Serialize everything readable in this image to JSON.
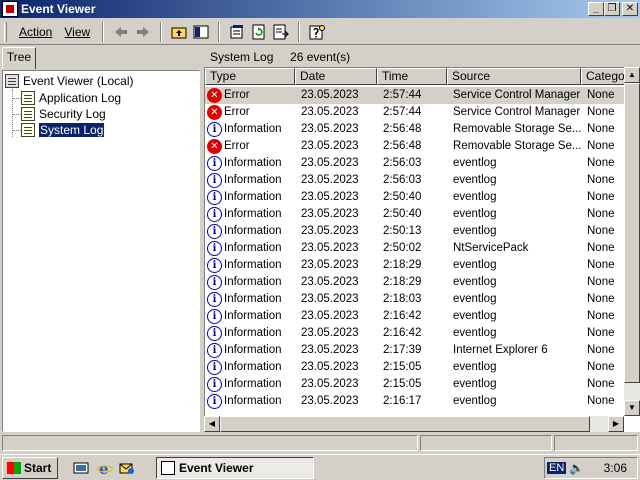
{
  "window": {
    "title": "Event Viewer"
  },
  "menu": {
    "action": "Action",
    "view": "View"
  },
  "tree": {
    "tab_label": "Tree",
    "root": "Event Viewer (Local)",
    "items": [
      "Application Log",
      "Security Log",
      "System Log"
    ],
    "selected": "System Log"
  },
  "header": {
    "log_name": "System Log",
    "event_count": "26 event(s)"
  },
  "columns": [
    "Type",
    "Date",
    "Time",
    "Source",
    "Catego"
  ],
  "rows": [
    {
      "type": "Error",
      "date": "23.05.2023",
      "time": "2:57:44",
      "source": "Service Control Manager",
      "category": "None"
    },
    {
      "type": "Error",
      "date": "23.05.2023",
      "time": "2:57:44",
      "source": "Service Control Manager",
      "category": "None"
    },
    {
      "type": "Information",
      "date": "23.05.2023",
      "time": "2:56:48",
      "source": "Removable Storage Se...",
      "category": "None"
    },
    {
      "type": "Error",
      "date": "23.05.2023",
      "time": "2:56:48",
      "source": "Removable Storage Se...",
      "category": "None"
    },
    {
      "type": "Information",
      "date": "23.05.2023",
      "time": "2:56:03",
      "source": "eventlog",
      "category": "None"
    },
    {
      "type": "Information",
      "date": "23.05.2023",
      "time": "2:56:03",
      "source": "eventlog",
      "category": "None"
    },
    {
      "type": "Information",
      "date": "23.05.2023",
      "time": "2:50:40",
      "source": "eventlog",
      "category": "None"
    },
    {
      "type": "Information",
      "date": "23.05.2023",
      "time": "2:50:40",
      "source": "eventlog",
      "category": "None"
    },
    {
      "type": "Information",
      "date": "23.05.2023",
      "time": "2:50:13",
      "source": "eventlog",
      "category": "None"
    },
    {
      "type": "Information",
      "date": "23.05.2023",
      "time": "2:50:02",
      "source": "NtServicePack",
      "category": "None"
    },
    {
      "type": "Information",
      "date": "23.05.2023",
      "time": "2:18:29",
      "source": "eventlog",
      "category": "None"
    },
    {
      "type": "Information",
      "date": "23.05.2023",
      "time": "2:18:29",
      "source": "eventlog",
      "category": "None"
    },
    {
      "type": "Information",
      "date": "23.05.2023",
      "time": "2:18:03",
      "source": "eventlog",
      "category": "None"
    },
    {
      "type": "Information",
      "date": "23.05.2023",
      "time": "2:16:42",
      "source": "eventlog",
      "category": "None"
    },
    {
      "type": "Information",
      "date": "23.05.2023",
      "time": "2:16:42",
      "source": "eventlog",
      "category": "None"
    },
    {
      "type": "Information",
      "date": "23.05.2023",
      "time": "2:17:39",
      "source": "Internet Explorer 6",
      "category": "None"
    },
    {
      "type": "Information",
      "date": "23.05.2023",
      "time": "2:15:05",
      "source": "eventlog",
      "category": "None"
    },
    {
      "type": "Information",
      "date": "23.05.2023",
      "time": "2:15:05",
      "source": "eventlog",
      "category": "None"
    },
    {
      "type": "Information",
      "date": "23.05.2023",
      "time": "2:16:17",
      "source": "eventlog",
      "category": "None"
    }
  ],
  "taskbar": {
    "start_label": "Start",
    "task_label": "Event Viewer",
    "language": "EN",
    "clock": "3:06"
  },
  "icons": {
    "error": "error-icon",
    "information": "information-icon"
  }
}
